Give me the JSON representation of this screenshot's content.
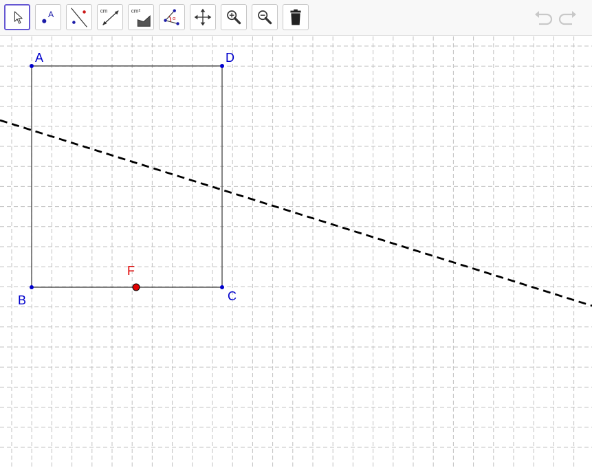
{
  "toolbar": {
    "tools": [
      {
        "name": "move-tool",
        "active": true
      },
      {
        "name": "point-tool",
        "icon_label": "A"
      },
      {
        "name": "line-tool"
      },
      {
        "name": "distance-tool",
        "icon_label": "cm"
      },
      {
        "name": "area-tool",
        "icon_label": "cm²"
      },
      {
        "name": "angle-tool",
        "icon_label": "α"
      },
      {
        "name": "move-graphics-view-tool"
      },
      {
        "name": "zoom-in-tool"
      },
      {
        "name": "zoom-out-tool"
      },
      {
        "name": "delete-tool"
      }
    ],
    "undo": {
      "icon": "undo-icon",
      "enabled": false
    },
    "redo": {
      "icon": "redo-icon",
      "enabled": false
    }
  },
  "canvas": {
    "grid": {
      "visible": true,
      "style": "dashed",
      "color": "#c0c0c0"
    },
    "points": [
      {
        "label": "A",
        "color": "#0000cc"
      },
      {
        "label": "D",
        "color": "#0000cc"
      },
      {
        "label": "B",
        "color": "#0000cc"
      },
      {
        "label": "C",
        "color": "#0000cc"
      },
      {
        "label": "F",
        "color": "#e00000"
      }
    ],
    "polygon": {
      "vertices": [
        "A",
        "D",
        "C",
        "B"
      ],
      "stroke": "#333333"
    },
    "dashed_line": {
      "color": "#000000",
      "style": "dashed"
    }
  },
  "colors": {
    "accent": "#6557d2",
    "point_blue": "#0000cc",
    "point_red": "#e00000"
  }
}
